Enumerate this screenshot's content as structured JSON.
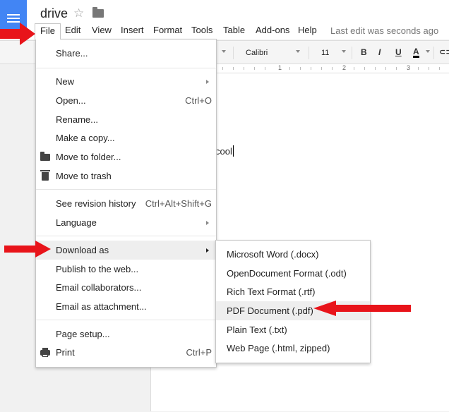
{
  "header": {
    "title": "drive",
    "last_edit": "Last edit was seconds ago"
  },
  "menubar": [
    "File",
    "Edit",
    "View",
    "Insert",
    "Format",
    "Tools",
    "Table",
    "Add-ons",
    "Help"
  ],
  "toolbar": {
    "font": "Calibri",
    "size": "11",
    "bold": "B",
    "italic": "I",
    "underline": "U",
    "text_color": "A"
  },
  "ruler": [
    "1",
    "2",
    "3"
  ],
  "document": {
    "text": "cool"
  },
  "file_menu": {
    "share": "Share...",
    "new": "New",
    "open": "Open...",
    "open_shortcut": "Ctrl+O",
    "rename": "Rename...",
    "make_copy": "Make a copy...",
    "move_to_folder": "Move to folder...",
    "move_to_trash": "Move to trash",
    "revision_history": "See revision history",
    "revision_shortcut": "Ctrl+Alt+Shift+G",
    "language": "Language",
    "download_as": "Download as",
    "publish": "Publish to the web...",
    "email_collaborators": "Email collaborators...",
    "email_attachment": "Email as attachment...",
    "page_setup": "Page setup...",
    "print": "Print",
    "print_shortcut": "Ctrl+P"
  },
  "download_menu": {
    "docx": "Microsoft Word (.docx)",
    "odt": "OpenDocument Format (.odt)",
    "rtf": "Rich Text Format (.rtf)",
    "pdf": "PDF Document (.pdf)",
    "txt": "Plain Text (.txt)",
    "html": "Web Page (.html, zipped)"
  },
  "colors": {
    "accent_blue": "#4285f4",
    "annotation_red": "#e8141a",
    "highlight": "#eeeeee"
  }
}
